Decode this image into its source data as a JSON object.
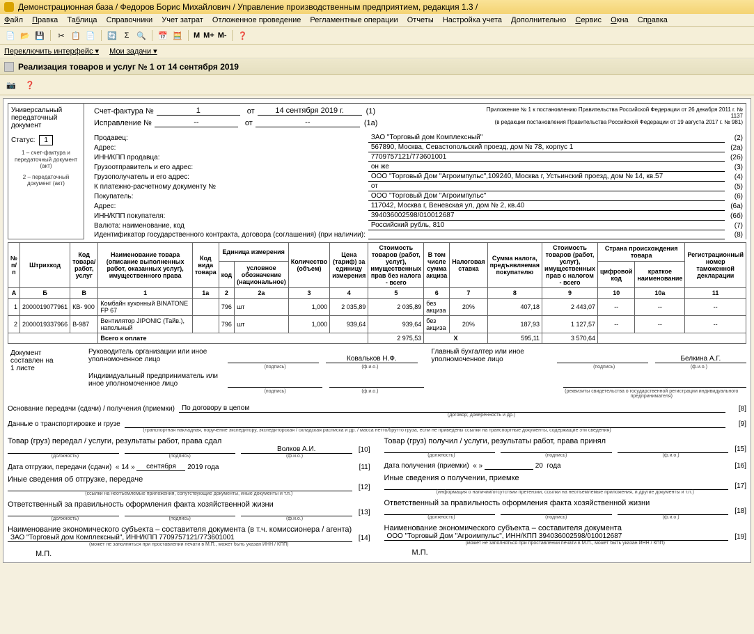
{
  "titlebar": "Демонстрационная база / Федоров Борис Михайлович / Управление производственным предприятием, редакция 1.3 /",
  "menu": [
    "Файл",
    "Правка",
    "Таблица",
    "Справочники",
    "Учет затрат",
    "Отложенное проведение",
    "Регламентные операции",
    "Отчеты",
    "Настройка учета",
    "Дополнительно",
    "Сервис",
    "Окна",
    "Справка"
  ],
  "switcher": {
    "a": "Переключить интерфейс ▾",
    "b": "Мои задачи ▾"
  },
  "doctitle": "Реализация товаров и услуг № 1 от 14 сентября 2019",
  "left": {
    "title1": "Универсальный",
    "title2": "передаточный",
    "title3": "документ",
    "status_lbl": "Статус:",
    "status_val": "1",
    "note1": "1 – счет-фактура и передаточный документ (акт)",
    "note2": "2 – передаточный документ (акт)"
  },
  "inv": {
    "l1": "Счет-фактура №",
    "n1": "1",
    "d1_lbl": "от",
    "d1": "14 сентября 2019 г.",
    "s1": "(1)",
    "l2": "Исправление №",
    "n2": "--",
    "d2_lbl": "от",
    "d2": "--",
    "s2": "(1а)"
  },
  "app": {
    "l1": "Приложение № 1 к постановлению Правительства Российской Федерации от 26 декабря 2011 г. № 1137",
    "l2": "(в редакции постановления Правительства Российской Федерации от 19 августа 2017 г. № 981)"
  },
  "info": [
    {
      "lbl": "Продавец:",
      "val": "ЗАО \"Торговый дом Комплексный\"",
      "ref": "(2)"
    },
    {
      "lbl": "Адрес:",
      "val": "567890, Москва, Севастопольский проезд, дом № 78, корпус 1",
      "ref": "(2а)"
    },
    {
      "lbl": "ИНН/КПП продавца:",
      "val": "7709757121/773601001",
      "ref": "(2б)"
    },
    {
      "lbl": "Грузоотправитель и его адрес:",
      "val": "он же",
      "ref": "(3)"
    },
    {
      "lbl": "Грузополучатель и его адрес:",
      "val": "ООО \"Торговый Дом \"Агроимпульс\",109240, Москва г, Устьинский проезд, дом № 14, кв.57",
      "ref": "(4)"
    },
    {
      "lbl": "К платежно-расчетному документу №",
      "val": "от",
      "ref": "(5)"
    },
    {
      "lbl": "Покупатель:",
      "val": "ООО \"Торговый Дом \"Агроимпульс\"",
      "ref": "(6)"
    },
    {
      "lbl": "Адрес:",
      "val": "117042, Москва г, Веневская ул, дом № 2, кв.40",
      "ref": "(6а)"
    },
    {
      "lbl": "ИНН/КПП покупателя:",
      "val": "394036002598/010012687",
      "ref": "(6б)"
    },
    {
      "lbl": "Валюта: наименование, код",
      "val": "Российский рубль, 810",
      "ref": "(7)"
    },
    {
      "lbl": "Идентификатор государственного контракта, договора (соглашения) (при наличии):",
      "val": "",
      "ref": "(8)"
    }
  ],
  "cols": {
    "c0": "№ п/п",
    "c1": "Штрихкод",
    "c2": "Код товара/ работ, услуг",
    "c3": "Наименование товара (описание выполненных работ, оказанных услуг), имущественного права",
    "c4": "Код вида товара",
    "c5": "Единица измерения",
    "c5a": "код",
    "c5b": "условное обозначение (национальное)",
    "c6": "Количество (объем)",
    "c7": "Цена (тариф) за единицу измерения",
    "c8": "Стоимость товаров (работ, услуг), имущественных прав без налога - всего",
    "c9": "В том числе сумма акциза",
    "c10": "Налоговая ставка",
    "c11": "Сумма налога, предъявляемая покупателю",
    "c12": "Стоимость товаров (работ, услуг), имущественных прав с налогом - всего",
    "c13": "Страна происхождения товара",
    "c13a": "цифровой код",
    "c13b": "краткое наименование",
    "c14": "Регистрационный номер таможенной декларации",
    "hA": "А",
    "hB": "Б",
    "hV": "В",
    "h1": "1",
    "h1a": "1а",
    "h2": "2",
    "h2a": "2а",
    "h3": "3",
    "h4": "4",
    "h5": "5",
    "h6": "6",
    "h7": "7",
    "h8": "8",
    "h9": "9",
    "h10": "10",
    "h10a": "10а",
    "h11": "11"
  },
  "rows": [
    {
      "n": "1",
      "bc": "2000019077961",
      "code": "КВ- 900",
      "name": "Комбайн кухонный BINATONE FP 67",
      "kind": "",
      "uc": "796",
      "un": "шт",
      "qty": "1,000",
      "price": "2 035,89",
      "sum": "2 035,89",
      "akz": "без акциза",
      "rate": "20%",
      "tax": "407,18",
      "total": "2 443,07",
      "cc": "--",
      "cn": "--",
      "dec": "--"
    },
    {
      "n": "2",
      "bc": "2000019337966",
      "code": "В-987",
      "name": "Вентилятор JIPONIC (Тайв.), напольный",
      "kind": "",
      "uc": "796",
      "un": "шт",
      "qty": "1,000",
      "price": "939,64",
      "sum": "939,64",
      "akz": "без акциза",
      "rate": "20%",
      "tax": "187,93",
      "total": "1 127,57",
      "cc": "--",
      "cn": "--",
      "dec": "--"
    }
  ],
  "totals": {
    "lbl": "Всего к оплате",
    "sum": "2 975,53",
    "x": "X",
    "tax": "595,11",
    "total": "3 570,64"
  },
  "sig": {
    "docinfo1": "Документ",
    "docinfo2": "составлен на",
    "docinfo3": "1 листе",
    "r1l": "Руководитель организации или иное уполномоченное лицо",
    "r1n": "Ковальков Н.Ф.",
    "r1r": "Главный бухгалтер или иное уполномоченное лицо",
    "r1rn": "Белкина А.Г.",
    "r2l": "Индивидуальный предприниматель или иное уполномоченное лицо",
    "sub_p": "(подпись)",
    "sub_f": "(ф.и.о.)",
    "sub_req": "(реквизиты свидетельства о государственной регистрации индивидуального предпринимателя)"
  },
  "bottom": {
    "b1_lbl": "Основание передачи (сдачи) / получения (приемки)",
    "b1_val": "По договору в целом",
    "b1_ref": "[8]",
    "b1_sub": "(договор; доверенность и др.)",
    "b2_lbl": "Данные о транспортировке и грузе",
    "b2_ref": "[9]",
    "b2_sub": "(транспортная накладная, поручение экспедитору, экспедиторская / складская расписка и др. / масса нетто/брутто груза, если не приведены ссылки на транспортные документы, содержащие эти сведения)"
  },
  "lcol": {
    "t1": "Товар (груз) передал / услуги, результаты работ, права сдал",
    "n1": "Волков А.И.",
    "r1": "[10]",
    "d_lbl": "Дата отгрузки, передачи (сдачи)",
    "d_d": "« 14 »",
    "d_m": "сентября",
    "d_y": "2019",
    "d_suf": "года",
    "d_ref": "[11]",
    "t2": "Иные сведения об отгрузке, передаче",
    "r2": "[12]",
    "sub2": "(ссылки на неотъемлемые приложения, сопутствующие документы, иные документы и т.п.)",
    "t3": "Ответственный за правильность оформления факта хозяйственной жизни",
    "r3": "[13]",
    "t4": "Наименование экономического субъекта – составителя документа (в т.ч. комиссионера / агента)",
    "t4v": "ЗАО \"Торговый дом Комплексный\", ИНН/КПП 7709757121/773601001",
    "r4": "[14]",
    "sub4": "(может не заполняться при проставлении печати в М.П., может быть указан ИНН / КПП)",
    "mp": "М.П.",
    "sub_d": "(должность)",
    "sub_p": "(подпись)",
    "sub_f": "(ф.и.о.)"
  },
  "rcol": {
    "t1": "Товар (груз) получил / услуги, результаты работ, права принял",
    "r1": "[15]",
    "d_lbl": "Дата получения (приемки)",
    "d_d": "«       »",
    "d_y": "20",
    "d_suf": "года",
    "d_ref": "[16]",
    "t2": "Иные сведения о получении, приемке",
    "r2": "[17]",
    "sub2": "(информация о наличии/отсутствии претензии; ссылки на неотъемлемые приложения, и другие документы и т.п.)",
    "t3": "Ответственный за правильность оформления факта хозяйственной жизни",
    "r3": "[18]",
    "t4": "Наименование экономического субъекта – составителя документа",
    "t4v": "ООО \"Торговый Дом \"Агроимпульс\", ИНН/КПП 394036002598/010012687",
    "r4": "[19]",
    "mp": "М.П."
  }
}
